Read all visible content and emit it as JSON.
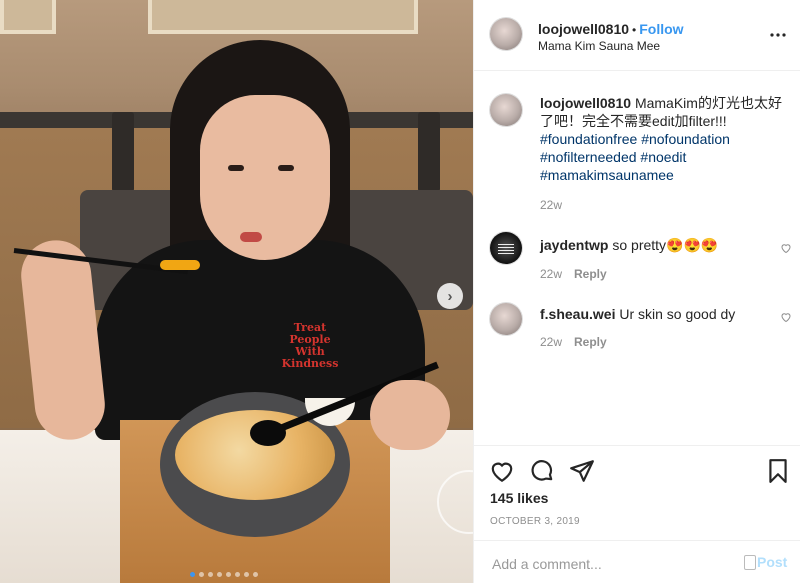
{
  "post": {
    "username": "loojowell0810",
    "follow_label": "Follow",
    "separator": "•",
    "location": "Mama Kim Sauna Mee",
    "more_icon": "more-options-icon",
    "photo": {
      "shirt_text": "Treat People With Kindness",
      "carousel_dots": 8,
      "active_dot": 0
    }
  },
  "caption": {
    "username": "loojowell0810",
    "text": "MamaKim的灯光也太好了吧！完全不需要edit加filter!!!",
    "hashtags": [
      "#foundationfree",
      "#nofoundation",
      "#nofilterneeded",
      "#noedit",
      "#mamakimsaunamee"
    ],
    "time": "22w"
  },
  "comments": [
    {
      "username": "jaydentwp",
      "text": "so pretty😍😍😍",
      "time": "22w",
      "reply_label": "Reply"
    },
    {
      "username": "f.sheau.wei",
      "text": "Ur skin so good dy",
      "time": "22w",
      "reply_label": "Reply"
    }
  ],
  "actions": {
    "likes": "145 likes",
    "date": "OCTOBER 3, 2019",
    "icons": [
      "heart-icon",
      "comment-icon",
      "share-icon",
      "bookmark-icon"
    ]
  },
  "add_comment": {
    "placeholder": "Add a comment...",
    "post_label": "Post"
  },
  "colors": {
    "link_blue": "#3897f0",
    "hashtag": "#003569",
    "muted": "#8e8e8e",
    "post_disabled": "#b2dffc"
  }
}
